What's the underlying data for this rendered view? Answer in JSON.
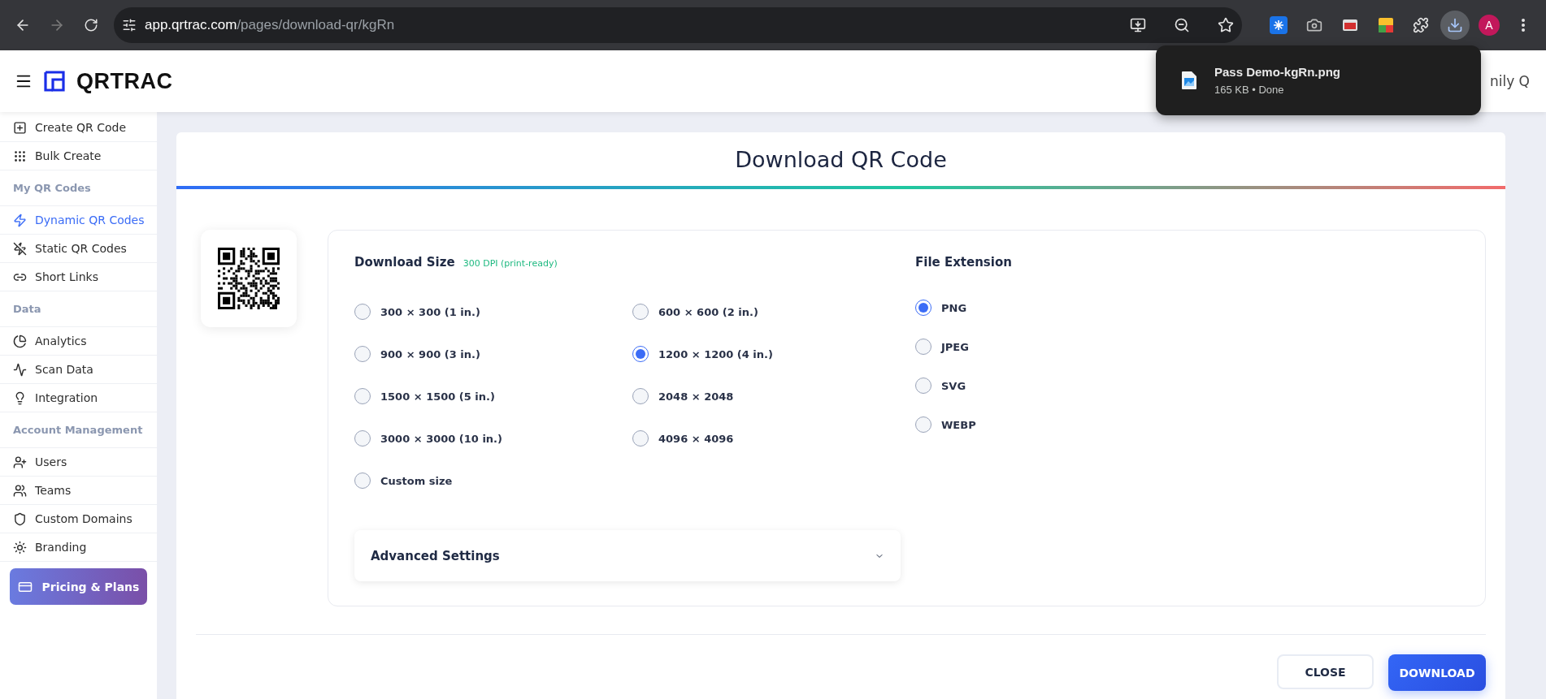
{
  "browser": {
    "url_host": "app.qrtrac.com",
    "url_path": "/pages/download-qr/kgRn",
    "profile_initial": "A"
  },
  "download_popup": {
    "filename": "Pass Demo-kgRn.png",
    "status": "165 KB • Done"
  },
  "header": {
    "logo": "QRTRAC",
    "user": "nily Q"
  },
  "sidebar": {
    "items": [
      {
        "kind": "link",
        "label": "Create QR Code",
        "selected": false
      },
      {
        "kind": "link",
        "label": "Bulk Create",
        "selected": false
      },
      {
        "kind": "section",
        "label": "My QR Codes"
      },
      {
        "kind": "link",
        "label": "Dynamic QR Codes",
        "selected": true
      },
      {
        "kind": "link",
        "label": "Static QR Codes",
        "selected": false
      },
      {
        "kind": "link",
        "label": "Short Links",
        "selected": false
      },
      {
        "kind": "section",
        "label": "Data"
      },
      {
        "kind": "link",
        "label": "Analytics",
        "selected": false
      },
      {
        "kind": "link",
        "label": "Scan Data",
        "selected": false
      },
      {
        "kind": "link",
        "label": "Integration",
        "selected": false
      },
      {
        "kind": "section",
        "label": "Account Management"
      },
      {
        "kind": "link",
        "label": "Users",
        "selected": false
      },
      {
        "kind": "link",
        "label": "Teams",
        "selected": false
      },
      {
        "kind": "link",
        "label": "Custom Domains",
        "selected": false
      },
      {
        "kind": "link",
        "label": "Branding",
        "selected": false
      }
    ],
    "pricing_button": "Pricing & Plans"
  },
  "dialog": {
    "title": "Download QR Code",
    "download_size": {
      "label": "Download Size",
      "hint": "300 DPI (print-ready)",
      "options": [
        {
          "label": "300 × 300 (1 in.)",
          "selected": false
        },
        {
          "label": "600 × 600 (2 in.)",
          "selected": false
        },
        {
          "label": "900 × 900 (3 in.)",
          "selected": false
        },
        {
          "label": "1200 × 1200 (4 in.)",
          "selected": true
        },
        {
          "label": "1500 × 1500 (5 in.)",
          "selected": false
        },
        {
          "label": "2048 × 2048",
          "selected": false
        },
        {
          "label": "3000 × 3000 (10 in.)",
          "selected": false
        },
        {
          "label": "4096 × 4096",
          "selected": false
        },
        {
          "label": "Custom size",
          "selected": false
        }
      ]
    },
    "file_extension": {
      "label": "File Extension",
      "options": [
        {
          "label": "PNG",
          "selected": true
        },
        {
          "label": "JPEG",
          "selected": false
        },
        {
          "label": "SVG",
          "selected": false
        },
        {
          "label": "WEBP",
          "selected": false
        }
      ]
    },
    "advanced_settings": {
      "label": "Advanced Settings",
      "expanded": false
    },
    "buttons": {
      "close": "CLOSE",
      "download": "DOWNLOAD"
    }
  }
}
